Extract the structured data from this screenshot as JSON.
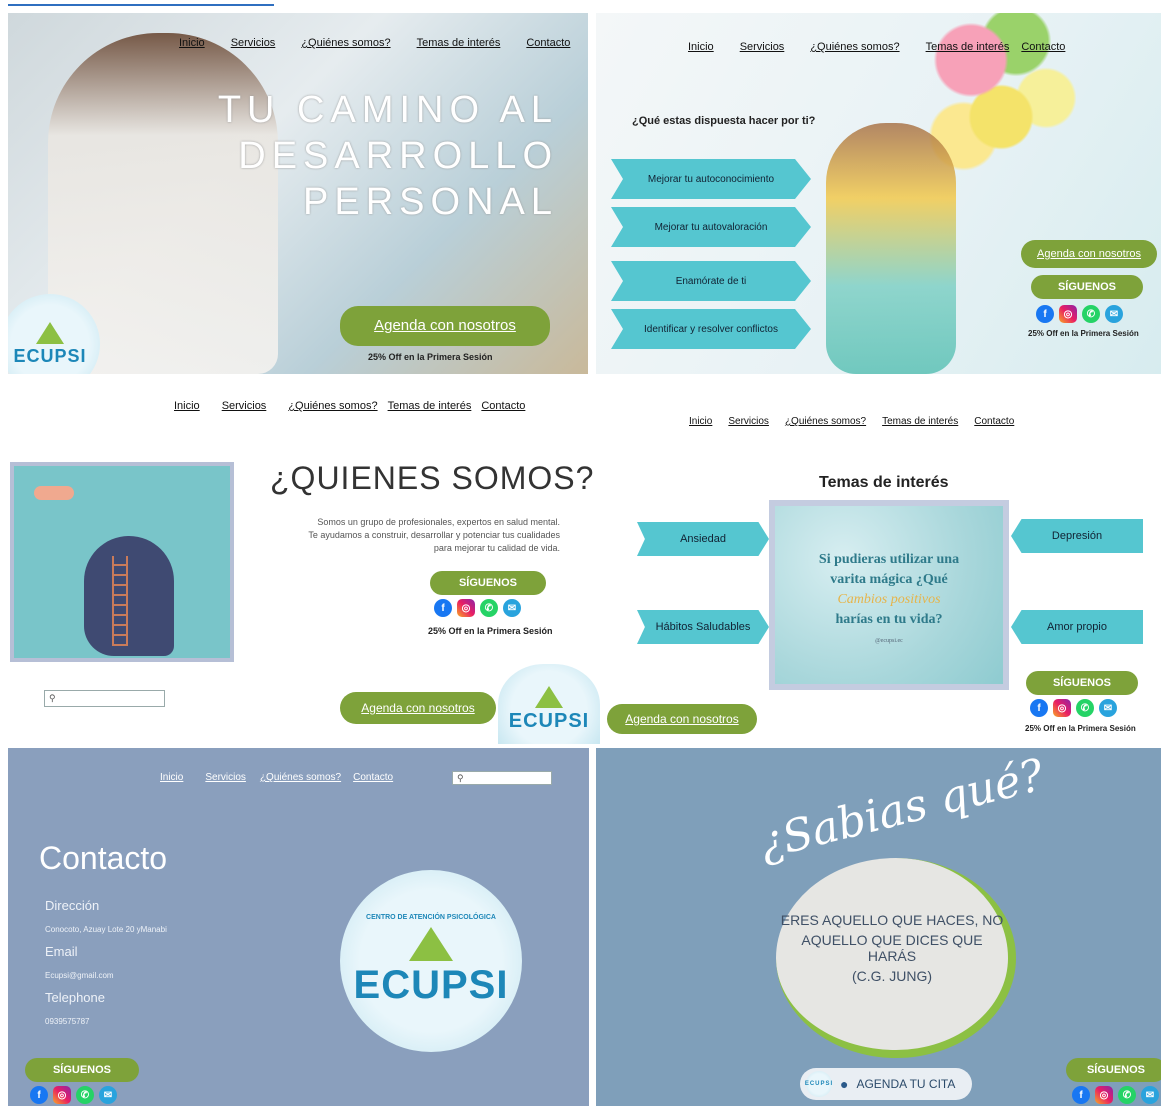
{
  "nav": {
    "inicio": "Inicio",
    "servicios": "Servicios",
    "quienes": "¿Quiénes somos?",
    "temas": "Temas de interés",
    "contacto": "Contacto"
  },
  "p1": {
    "headline_1": "TU CAMINO AL",
    "headline_2": "DESARROLLO",
    "headline_3": "PERSONAL",
    "cta": "Agenda con nosotros",
    "promo": "25% Off en la Primera Sesión",
    "logo": "ECUPSI"
  },
  "p2": {
    "question": "¿Qué estas dispuesta hacer por ti?",
    "options": [
      "Mejorar tu autoconocimiento",
      "Mejorar tu autovaloración",
      "Enamórate de ti",
      "Identificar y resolver conflictos"
    ],
    "cta": "Agenda con nosotros",
    "follow": "SÍGUENOS",
    "promo": "25% Off en la Primera Sesión"
  },
  "p3": {
    "title": "¿QUIENES SOMOS?",
    "body_1": "Somos un grupo de profesionales, expertos en salud mental.",
    "body_2": "Te ayudamos a construir, desarrollar y potenciar tus cualidades",
    "body_3": "para mejorar tu calidad de vida.",
    "follow": "SÍGUENOS",
    "promo": "25% Off en la Primera Sesión",
    "cta": "Agenda con nosotros",
    "logo": "ECUPSI"
  },
  "p4": {
    "title": "Temas de interés",
    "topics": [
      "Ansiedad",
      "Depresión",
      "Hábitos Saludables",
      "Amor propio"
    ],
    "quote_1": "Si pudieras utilizar una",
    "quote_2": "varita mágica ¿Qué",
    "quote_3": "Cambios positivos",
    "quote_4": "harías en tu vida?",
    "handle": "@ecupsi.ec",
    "follow": "SÍGUENOS",
    "promo": "25% Off en la Primera Sesión",
    "cta": "Agenda con nosotros"
  },
  "p5": {
    "title": "Contacto",
    "dir_label": "Dirección",
    "dir_value": "Conocoto, Azuay Lote 20 yManabi",
    "email_label": "Email",
    "email_value": "Ecupsi@gmail.com",
    "tel_label": "Telephone",
    "tel_value": "0939575787",
    "follow": "SÍGUENOS",
    "logo": "ECUPSI",
    "logo_ring": "CENTRO DE ATENCIÓN PSICOLÓGICA"
  },
  "p6": {
    "title": "¿Sabias qué?",
    "quote_1": "ERES AQUELLO QUE HACES, NO",
    "quote_2": "AQUELLO QUE DICES QUE HARÁS",
    "quote_3": "(C.G. JUNG)",
    "cta": "AGENDA TU CITA",
    "follow": "SÍGUENOS",
    "logo": "ECUPSI"
  },
  "colors": {
    "green": "#7ea23a",
    "teal": "#55c6d0",
    "slate": "#8a9fbd",
    "steel": "#7f9fba"
  }
}
